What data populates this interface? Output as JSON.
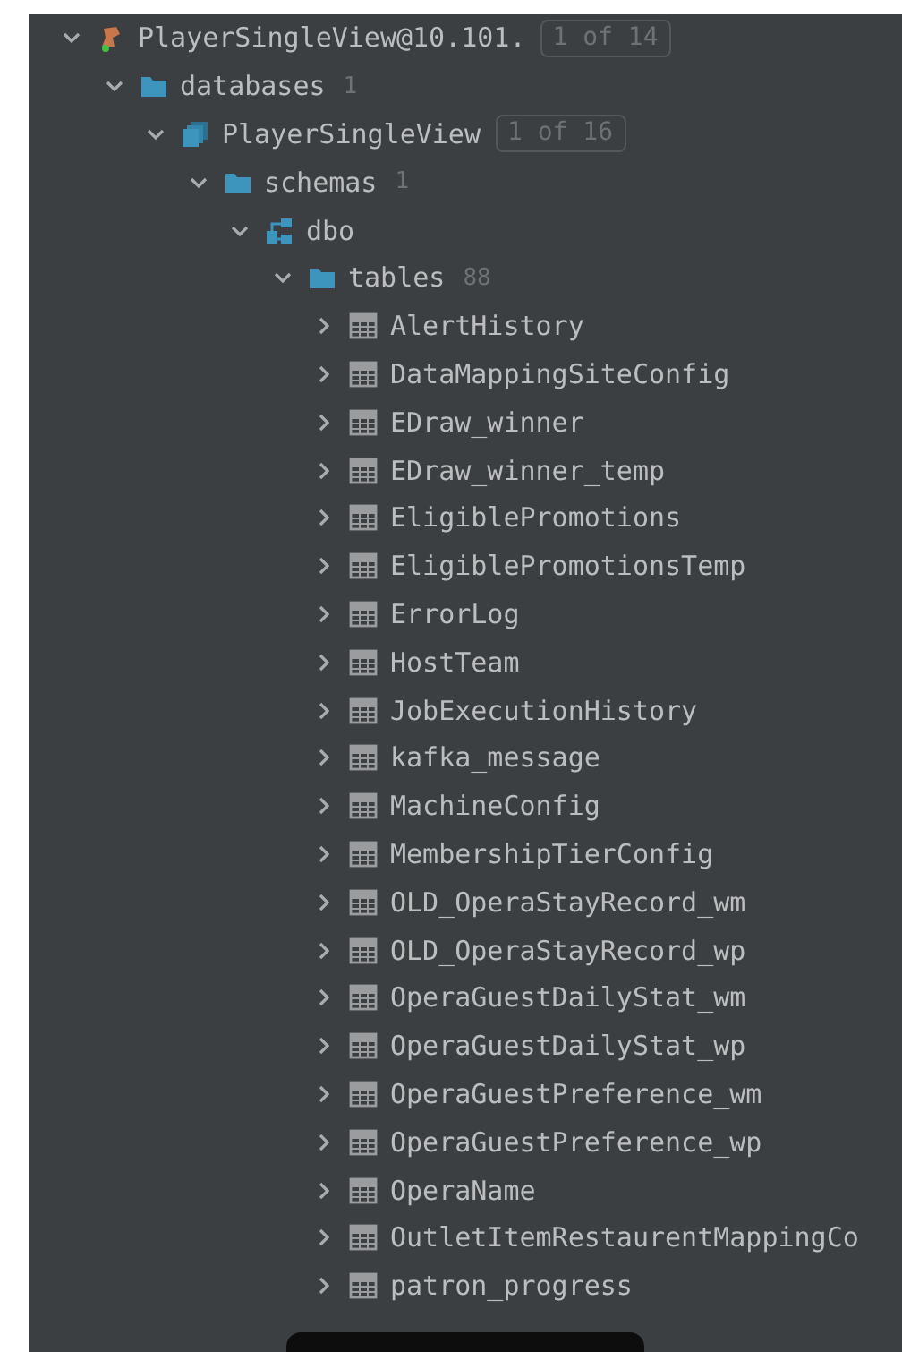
{
  "tree": [
    {
      "kind": "connection",
      "label": "PlayerSingleView@10.101.",
      "badge": "1 of 14",
      "expanded": true,
      "children": [
        {
          "kind": "folder",
          "label": "databases",
          "count": "1",
          "expanded": true,
          "children": [
            {
              "kind": "database",
              "label": "PlayerSingleView",
              "badge": "1 of 16",
              "expanded": true,
              "children": [
                {
                  "kind": "folder",
                  "label": "schemas",
                  "count": "1",
                  "expanded": true,
                  "children": [
                    {
                      "kind": "schema",
                      "label": "dbo",
                      "expanded": true,
                      "children": [
                        {
                          "kind": "folder",
                          "label": "tables",
                          "count": "88",
                          "expanded": true,
                          "children": [
                            {
                              "kind": "table",
                              "label": "AlertHistory",
                              "expanded": false
                            },
                            {
                              "kind": "table",
                              "label": "DataMappingSiteConfig",
                              "expanded": false
                            },
                            {
                              "kind": "table",
                              "label": "EDraw_winner",
                              "expanded": false
                            },
                            {
                              "kind": "table",
                              "label": "EDraw_winner_temp",
                              "expanded": false
                            },
                            {
                              "kind": "table",
                              "label": "EligiblePromotions",
                              "expanded": false
                            },
                            {
                              "kind": "table",
                              "label": "EligiblePromotionsTemp",
                              "expanded": false
                            },
                            {
                              "kind": "table",
                              "label": "ErrorLog",
                              "expanded": false
                            },
                            {
                              "kind": "table",
                              "label": "HostTeam",
                              "expanded": false
                            },
                            {
                              "kind": "table",
                              "label": "JobExecutionHistory",
                              "expanded": false
                            },
                            {
                              "kind": "table",
                              "label": "kafka_message",
                              "expanded": false
                            },
                            {
                              "kind": "table",
                              "label": "MachineConfig",
                              "expanded": false
                            },
                            {
                              "kind": "table",
                              "label": "MembershipTierConfig",
                              "expanded": false
                            },
                            {
                              "kind": "table",
                              "label": "OLD_OperaStayRecord_wm",
                              "expanded": false
                            },
                            {
                              "kind": "table",
                              "label": "OLD_OperaStayRecord_wp",
                              "expanded": false
                            },
                            {
                              "kind": "table",
                              "label": "OperaGuestDailyStat_wm",
                              "expanded": false
                            },
                            {
                              "kind": "table",
                              "label": "OperaGuestDailyStat_wp",
                              "expanded": false
                            },
                            {
                              "kind": "table",
                              "label": "OperaGuestPreference_wm",
                              "expanded": false
                            },
                            {
                              "kind": "table",
                              "label": "OperaGuestPreference_wp",
                              "expanded": false
                            },
                            {
                              "kind": "table",
                              "label": "OperaName",
                              "expanded": false
                            },
                            {
                              "kind": "table",
                              "label": "OutletItemRestaurentMappingCo",
                              "expanded": false
                            },
                            {
                              "kind": "table",
                              "label": "patron_progress",
                              "expanded": false
                            }
                          ]
                        }
                      ]
                    }
                  ]
                }
              ]
            }
          ]
        }
      ]
    }
  ]
}
